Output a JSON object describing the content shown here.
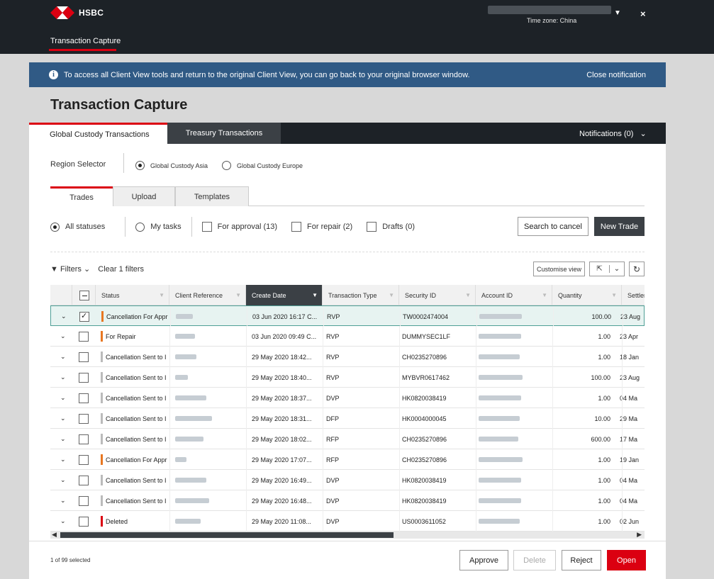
{
  "app": {
    "brand": "HSBC",
    "timezone": "Time zone: China",
    "top_tab": "Transaction Capture",
    "colors": {
      "accent_red": "#db0011",
      "topbar": "#1d2227",
      "notification": "#305a85"
    }
  },
  "notification": {
    "text": "To access all Client View tools and return to the original Client View, you can go back to your original browser window.",
    "close_label": "Close notification"
  },
  "page_title": "Transaction Capture",
  "main_tabs": [
    {
      "label": "Global Custody Transactions",
      "active": true
    },
    {
      "label": "Treasury Transactions",
      "active": false
    }
  ],
  "notifications_label": "Notifications (0)",
  "region": {
    "label": "Region Selector",
    "options": [
      {
        "label": "Global Custody Asia",
        "selected": true
      },
      {
        "label": "Global Custody Europe",
        "selected": false
      }
    ]
  },
  "sub_tabs": [
    "Trades",
    "Upload",
    "Templates"
  ],
  "status_filters": {
    "all": "All statuses",
    "my": "My tasks",
    "approval": "For approval (13)",
    "repair": "For repair (2)",
    "drafts": "Drafts (0)"
  },
  "actions": {
    "search_cancel": "Search to cancel",
    "new_trade": "New Trade"
  },
  "filters": {
    "label": "Filters",
    "clear": "Clear 1 filters",
    "customise": "Customise view"
  },
  "columns": [
    "Status",
    "Client Reference",
    "Create Date",
    "Transaction Type",
    "Security ID",
    "Account ID",
    "Quantity",
    "Settler"
  ],
  "rows": [
    {
      "status": "Cancellation For Appr",
      "status_color": "#e87722",
      "date": "03 Jun 2020 16:17 C...",
      "type": "RVP",
      "security": "TW0002474004",
      "qty": "100.00",
      "settle": "23 Aug",
      "checked": true
    },
    {
      "status": "For Repair",
      "status_color": "#e87722",
      "date": "03 Jun 2020 09:49 C...",
      "type": "RVP",
      "security": "DUMMYSEC1LF",
      "qty": "1.00",
      "settle": "23 Apr",
      "checked": false
    },
    {
      "status": "Cancellation Sent to I",
      "status_color": "#bbbbbb",
      "date": "29 May 2020 18:42...",
      "type": "RVP",
      "security": "CH0235270896",
      "qty": "1.00",
      "settle": "18 Jan",
      "checked": false
    },
    {
      "status": "Cancellation Sent to I",
      "status_color": "#bbbbbb",
      "date": "29 May 2020 18:40...",
      "type": "RVP",
      "security": "MYBVR0617462",
      "qty": "100.00",
      "settle": "23 Aug",
      "checked": false
    },
    {
      "status": "Cancellation Sent to I",
      "status_color": "#bbbbbb",
      "date": "29 May 2020 18:37...",
      "type": "DVP",
      "security": "HK0820038419",
      "qty": "1.00",
      "settle": "04 Ma",
      "checked": false
    },
    {
      "status": "Cancellation Sent to I",
      "status_color": "#bbbbbb",
      "date": "29 May 2020 18:31...",
      "type": "DFP",
      "security": "HK0004000045",
      "qty": "10.00",
      "settle": "29 Ma",
      "checked": false
    },
    {
      "status": "Cancellation Sent to I",
      "status_color": "#bbbbbb",
      "date": "29 May 2020 18:02...",
      "type": "RFP",
      "security": "CH0235270896",
      "qty": "600.00",
      "settle": "17 Ma",
      "checked": false
    },
    {
      "status": "Cancellation For Appr",
      "status_color": "#e87722",
      "date": "29 May 2020 17:07...",
      "type": "RFP",
      "security": "CH0235270896",
      "qty": "1.00",
      "settle": "19 Jan",
      "checked": false
    },
    {
      "status": "Cancellation Sent to I",
      "status_color": "#bbbbbb",
      "date": "29 May 2020 16:49...",
      "type": "DVP",
      "security": "HK0820038419",
      "qty": "1.00",
      "settle": "04 Ma",
      "checked": false
    },
    {
      "status": "Cancellation Sent to I",
      "status_color": "#bbbbbb",
      "date": "29 May 2020 16:48...",
      "type": "DVP",
      "security": "HK0820038419",
      "qty": "1.00",
      "settle": "04 Ma",
      "checked": false
    },
    {
      "status": "Deleted",
      "status_color": "#db0011",
      "date": "29 May 2020 11:08...",
      "type": "DVP",
      "security": "US0003611052",
      "qty": "1.00",
      "settle": "02 Jun",
      "checked": false
    }
  ],
  "footer": {
    "selected": "1 of 99 selected",
    "approve": "Approve",
    "delete": "Delete",
    "reject": "Reject",
    "open": "Open"
  }
}
